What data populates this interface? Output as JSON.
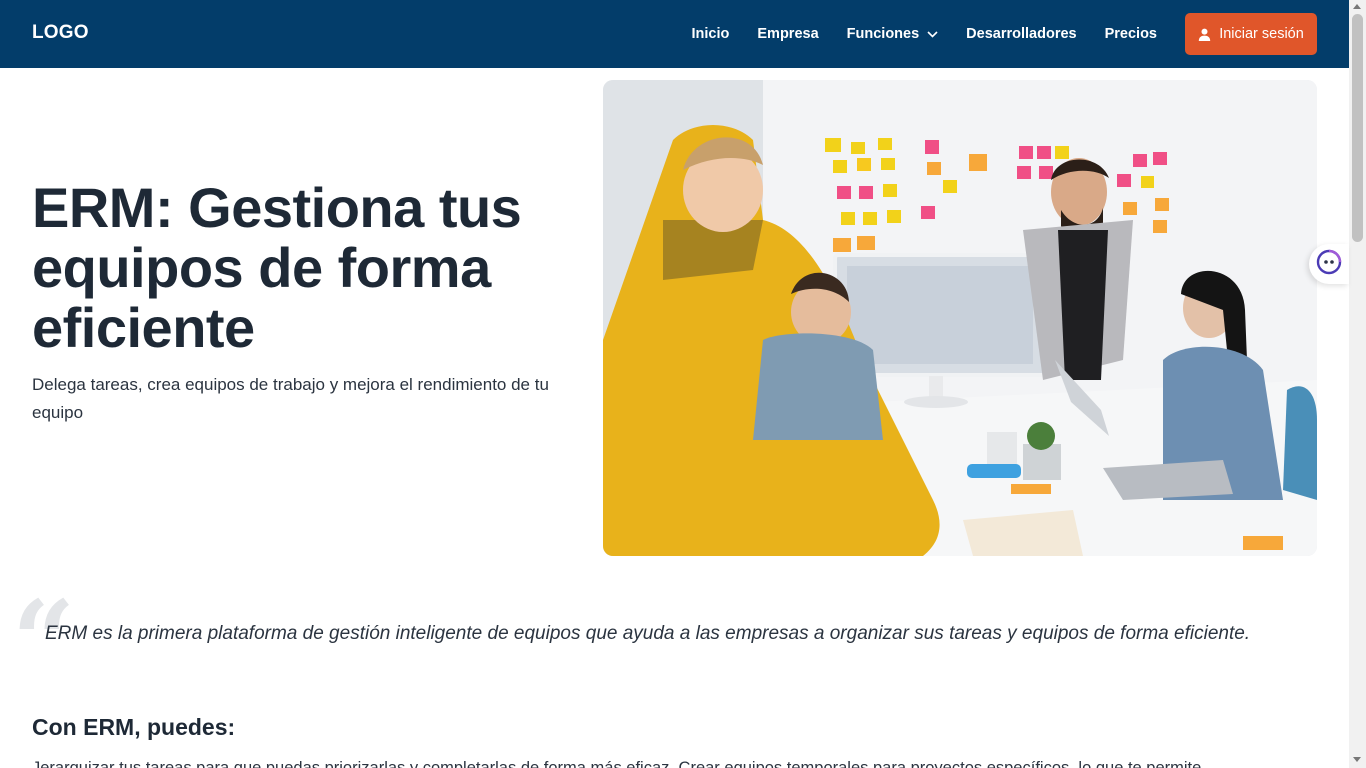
{
  "header": {
    "logo": "LOGO",
    "nav": [
      "Inicio",
      "Empresa",
      "Funciones",
      "Desarrolladores",
      "Precios"
    ],
    "login_label": "Iniciar sesión",
    "colors": {
      "background": "#033d6a",
      "accent": "#e0562a"
    }
  },
  "hero": {
    "title": "ERM: Gestiona tus equipos de forma eficiente",
    "subtitle": "Delega tareas, crea equipos de trabajo y mejora el rendimiento de tu equipo",
    "image_icon": "team-meeting-photo"
  },
  "quote": {
    "text": "ERM es la primera plataforma de gestión inteligente de equipos que ayuda a las empresas a organizar sus tareas y equipos de forma eficiente."
  },
  "features": {
    "title": "Con ERM, puedes:",
    "text": "Jerarquizar tus tareas para que puedas priorizarlas y completarlas de forma más eficaz. Crear equipos temporales para proyectos específicos, lo que te permite"
  },
  "widget": {
    "icon": "chatbot-icon"
  }
}
